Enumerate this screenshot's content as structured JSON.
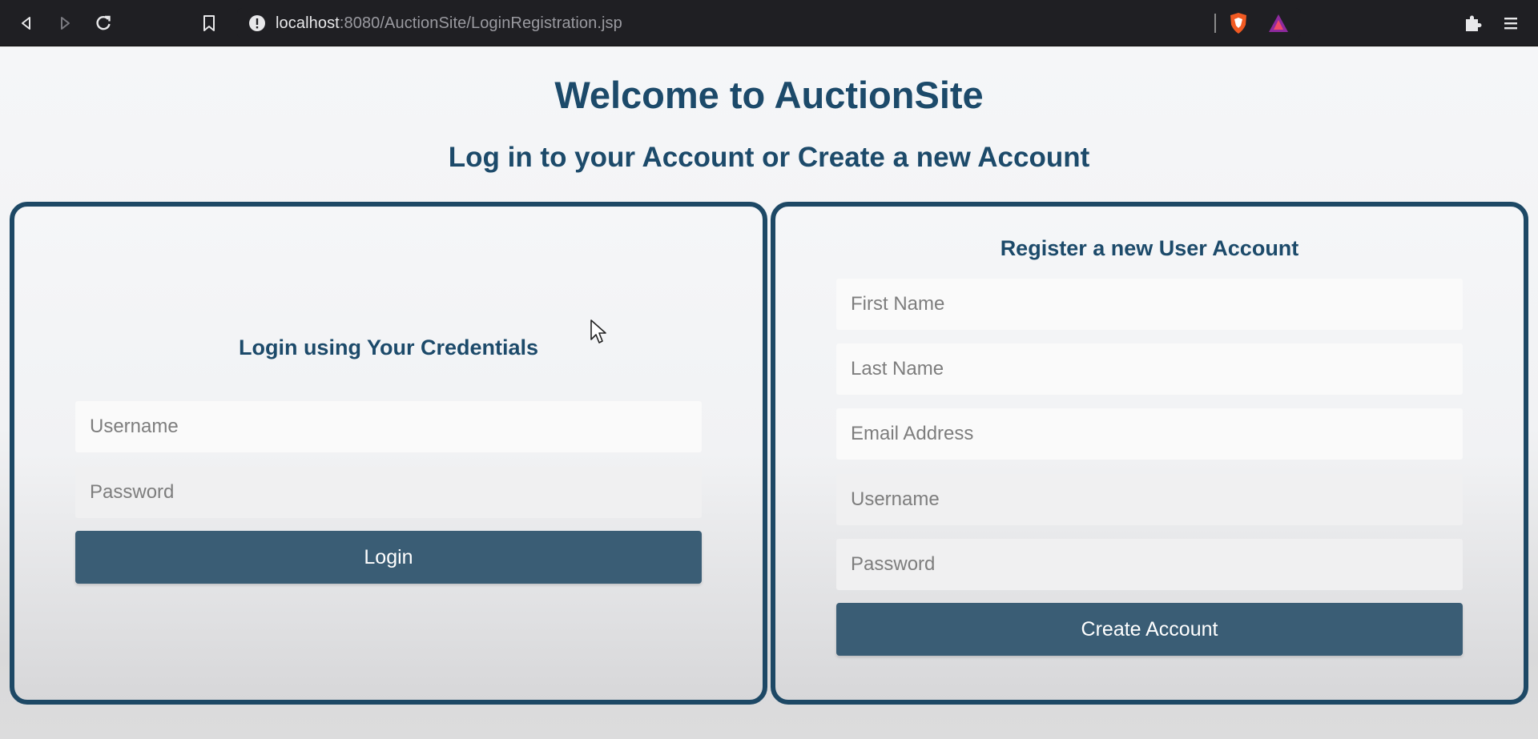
{
  "browser": {
    "url_host": "localhost",
    "url_path": ":8080/AuctionSite/LoginRegistration.jsp"
  },
  "page": {
    "welcome": "Welcome to AuctionSite",
    "subtitle": "Log in to your Account or Create a new Account"
  },
  "login": {
    "heading": "Login using Your Credentials",
    "username_placeholder": "Username",
    "password_placeholder": "Password",
    "button_label": "Login"
  },
  "register": {
    "heading": "Register a new User Account",
    "first_name_placeholder": "First Name",
    "last_name_placeholder": "Last Name",
    "email_placeholder": "Email Address",
    "username_placeholder": "Username",
    "password_placeholder": "Password",
    "button_label": "Create Account"
  },
  "colors": {
    "primary_text": "#1c4a6a",
    "panel_border": "#1d4865",
    "button": "#3a5d75"
  }
}
